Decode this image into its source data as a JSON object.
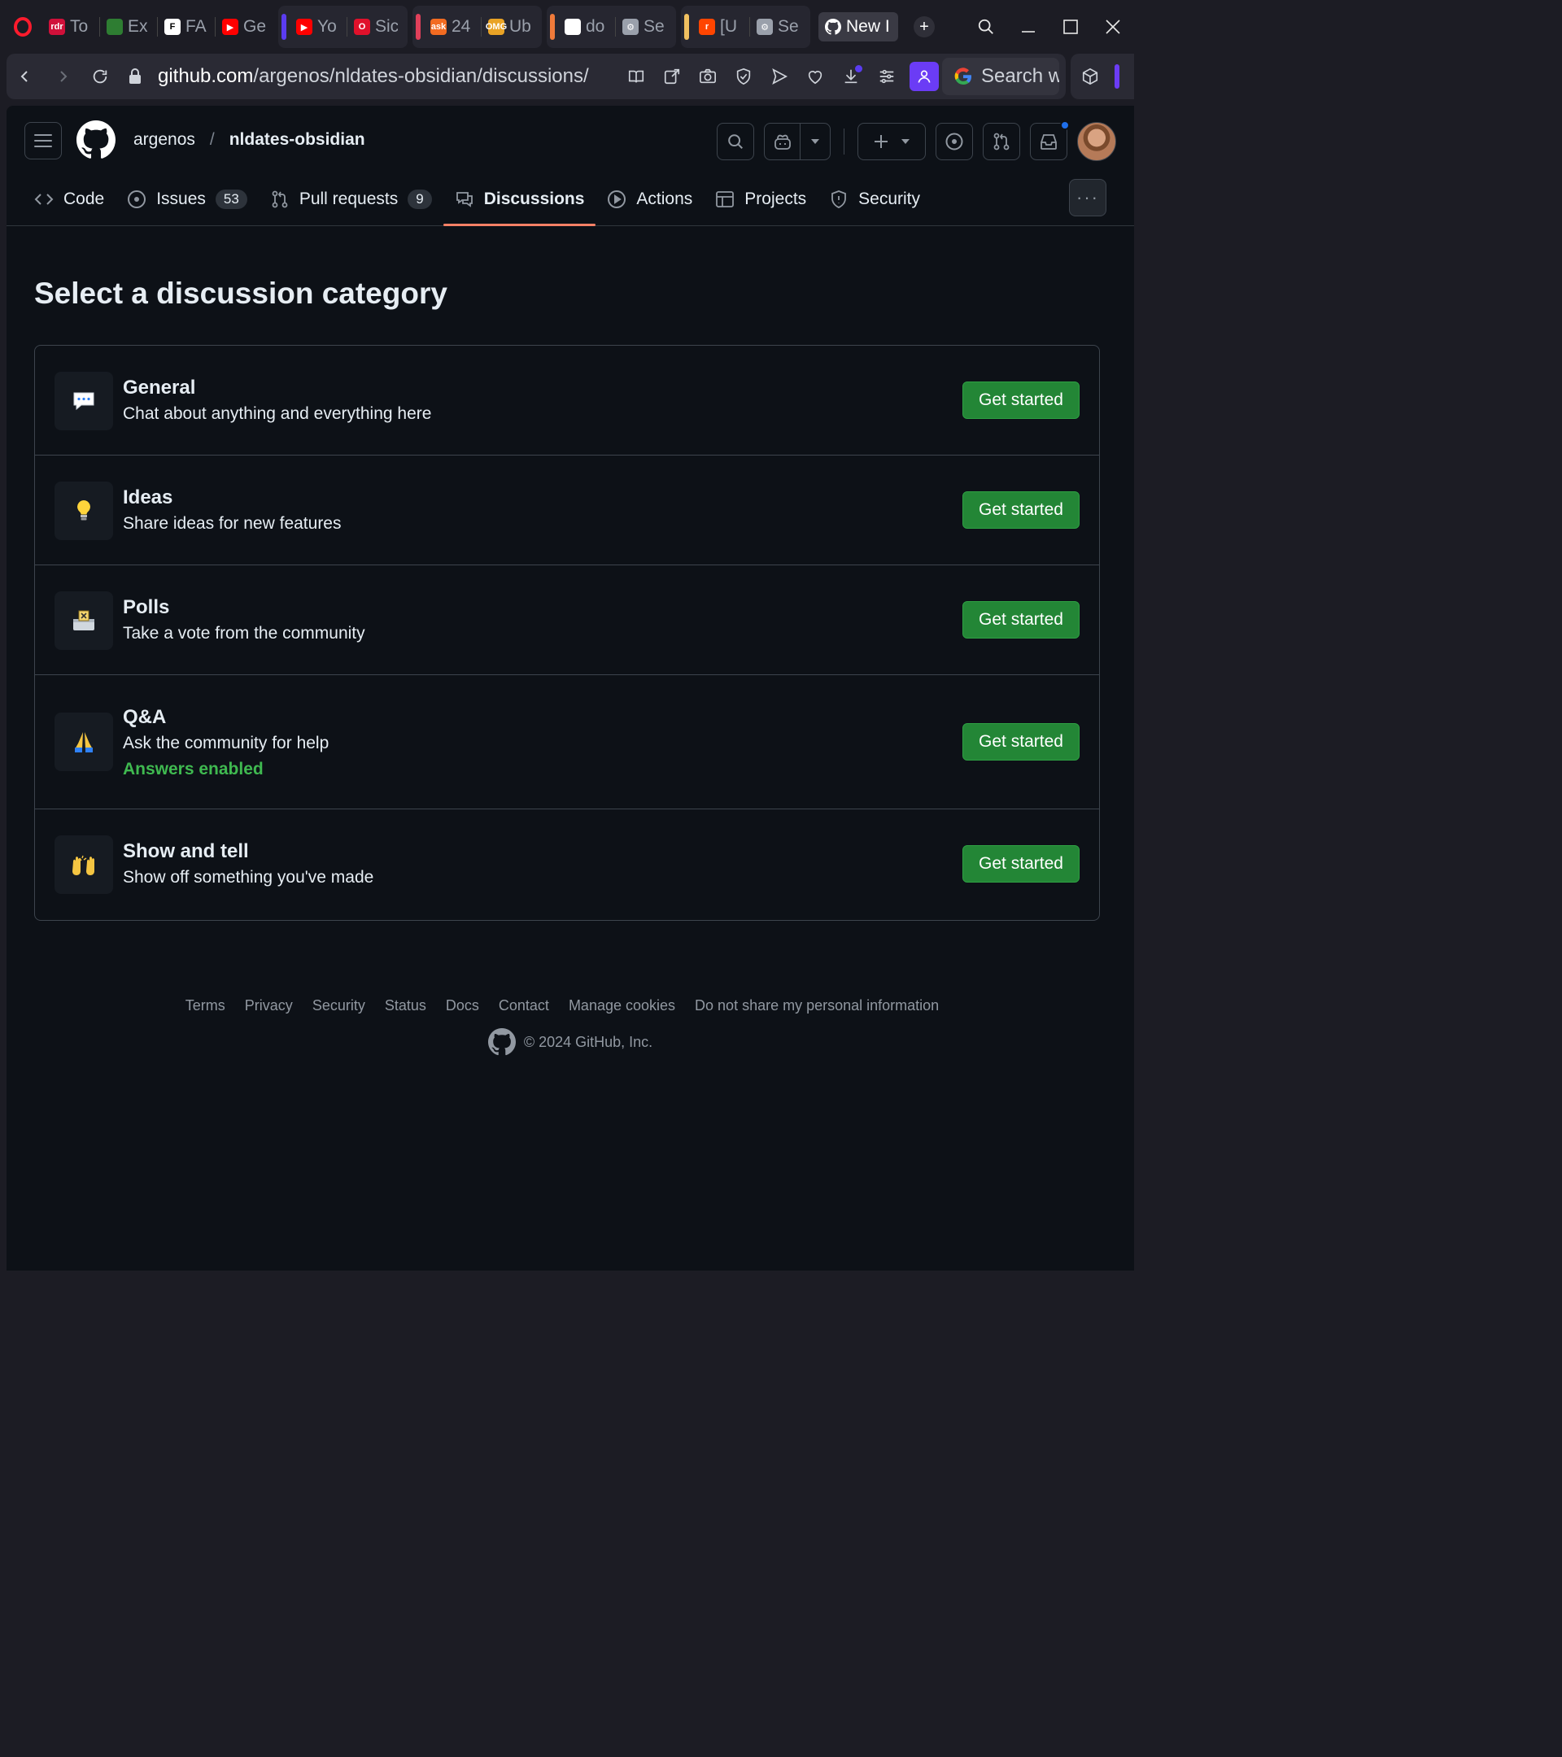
{
  "browser": {
    "tab_groups": [
      {
        "bar": "",
        "tabs": [
          {
            "label": "To",
            "fav_color": "#d0103a",
            "fav_text": "rdr"
          },
          {
            "label": "Ex",
            "fav_color": "#2e7d32",
            "fav_text": ""
          },
          {
            "label": "FA",
            "fav_color": "#ffffff",
            "fav_text": "F"
          },
          {
            "label": "Ge",
            "fav_color": "#ff0000",
            "fav_text": "▶"
          }
        ]
      },
      {
        "bar": "#5b3cf0",
        "tabs": [
          {
            "label": "Yo",
            "fav_color": "#ff0000",
            "fav_text": "▶"
          },
          {
            "label": "Sic",
            "fav_color": "#e0112b",
            "fav_text": "O"
          }
        ]
      },
      {
        "bar": "#e0405a",
        "tabs": [
          {
            "label": "24",
            "fav_color": "#f26b21",
            "fav_text": "ask"
          },
          {
            "label": "Ub",
            "fav_color": "#e9a326",
            "fav_text": "OMG"
          }
        ]
      },
      {
        "bar": "#f07a3a",
        "tabs": [
          {
            "label": "do",
            "fav_color": "#ffffff",
            "fav_text": ""
          },
          {
            "label": "Se",
            "fav_color": "#9aa0ab",
            "fav_text": "⚙"
          }
        ]
      },
      {
        "bar": "#f0c060",
        "tabs": [
          {
            "label": "[U",
            "fav_color": "#ff4500",
            "fav_text": "r"
          },
          {
            "label": "Se",
            "fav_color": "#9aa0ab",
            "fav_text": "⚙"
          }
        ]
      }
    ],
    "active_tab": {
      "label": "New I"
    },
    "url_host": "github.com",
    "url_path": "/argenos/nldates-obsidian/discussions/",
    "search_placeholder": "Search w"
  },
  "header": {
    "owner": "argenos",
    "separator": "/",
    "repo": "nldates-obsidian"
  },
  "repo_nav": {
    "tabs": [
      {
        "label": "Code",
        "icon": "code-icon"
      },
      {
        "label": "Issues",
        "icon": "issue-icon",
        "count": "53"
      },
      {
        "label": "Pull requests",
        "icon": "pull-request-icon",
        "count": "9"
      },
      {
        "label": "Discussions",
        "icon": "discussion-icon",
        "selected": true
      },
      {
        "label": "Actions",
        "icon": "play-icon"
      },
      {
        "label": "Projects",
        "icon": "table-icon"
      },
      {
        "label": "Security",
        "icon": "shield-icon"
      }
    ],
    "more": "···"
  },
  "main": {
    "title": "Select a discussion category",
    "categories": [
      {
        "name": "General",
        "description": "Chat about anything and everything here",
        "emoji": "💬",
        "button": "Get started"
      },
      {
        "name": "Ideas",
        "description": "Share ideas for new features",
        "emoji": "💡",
        "button": "Get started"
      },
      {
        "name": "Polls",
        "description": "Take a vote from the community",
        "emoji": "🗳",
        "button": "Get started"
      },
      {
        "name": "Q&A",
        "description": "Ask the community for help",
        "extra": "Answers enabled",
        "emoji": "🙏",
        "button": "Get started"
      },
      {
        "name": "Show and tell",
        "description": "Show off something you've made",
        "emoji": "🙌",
        "button": "Get started"
      }
    ]
  },
  "footer": {
    "links": [
      "Terms",
      "Privacy",
      "Security",
      "Status",
      "Docs",
      "Contact",
      "Manage cookies",
      "Do not share my personal information"
    ],
    "copyright": "© 2024 GitHub, Inc."
  },
  "colors": {
    "page_bg": "#0d1117",
    "accent_underline": "#f78166",
    "button_green": "#238636",
    "answers_green": "#3fb950"
  }
}
